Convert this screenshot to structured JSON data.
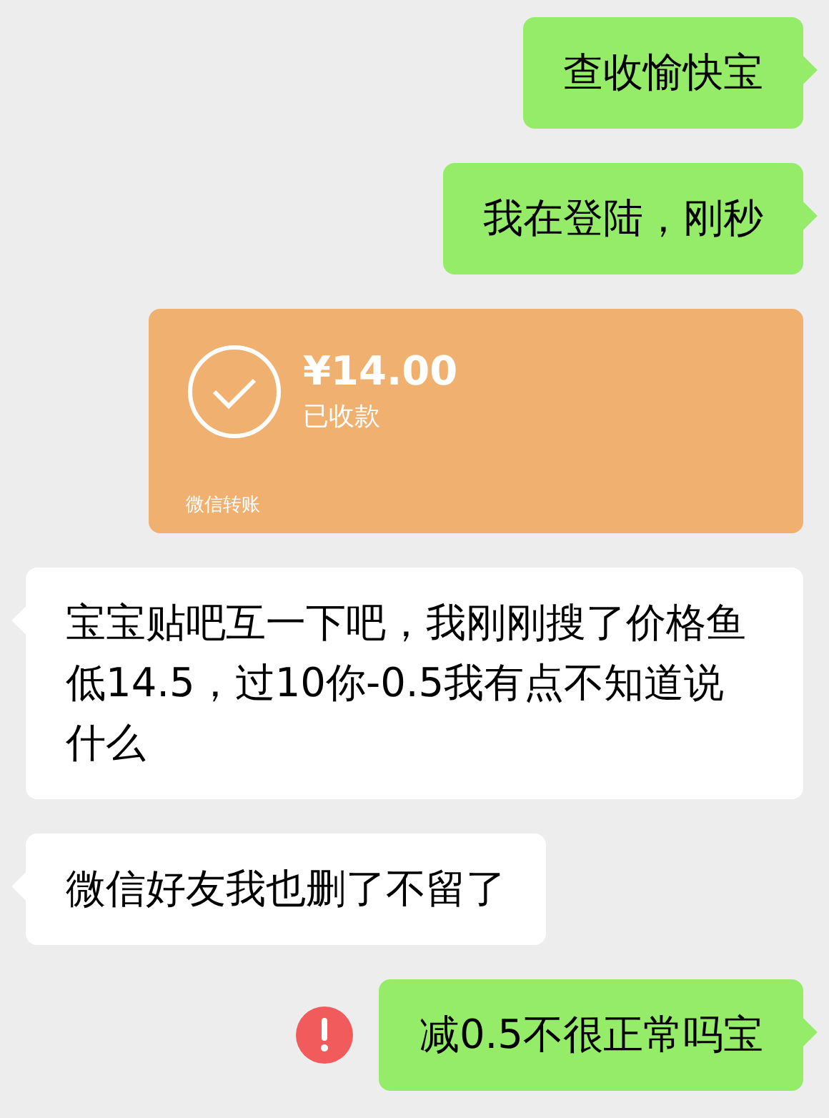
{
  "messages": [
    {
      "kind": "text",
      "outgoing": true,
      "text": "查收愉快宝",
      "failed": false
    },
    {
      "kind": "text",
      "outgoing": true,
      "text": "我在登陆，刚秒",
      "failed": false
    },
    {
      "kind": "transfer",
      "outgoing": true,
      "amount": "¥14.00",
      "status": "已收款",
      "footer": "微信转账"
    },
    {
      "kind": "text",
      "outgoing": false,
      "text": "宝宝贴吧互一下吧，我刚刚搜了价格鱼低14.5，过10你-0.5我有点不知道说什么",
      "failed": false
    },
    {
      "kind": "text",
      "outgoing": false,
      "text": "微信好友我也删了不留了",
      "failed": false
    },
    {
      "kind": "text",
      "outgoing": true,
      "text": "减0.5不很正常吗宝",
      "failed": true
    }
  ]
}
